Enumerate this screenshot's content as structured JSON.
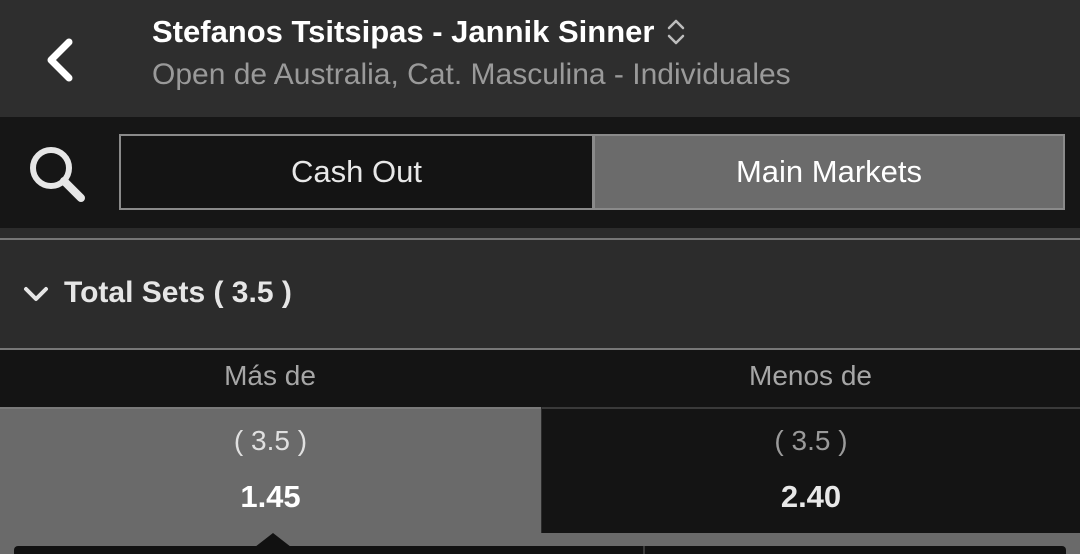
{
  "header": {
    "match_title": "Stefanos Tsitsipas - Jannik Sinner",
    "subtitle": "Open de Australia, Cat. Masculina - Individuales",
    "back_icon": "chevron-left-icon",
    "switch_icon": "chevron-up-down-icon"
  },
  "tabs": {
    "search_icon": "search-icon",
    "items": [
      {
        "label": "Cash Out",
        "active": false
      },
      {
        "label": "Main Markets",
        "active": true
      }
    ]
  },
  "market": {
    "title": "Total Sets",
    "line_label": "( 3.5 )",
    "expanded": true,
    "columns": {
      "over": "Más de",
      "under": "Menos de"
    },
    "selections": {
      "over": {
        "line": "( 3.5 )",
        "price": "1.45",
        "selected": true
      },
      "under": {
        "line": "( 3.5 )",
        "price": "2.40",
        "selected": false
      }
    }
  },
  "colors": {
    "background": "#2b2b2b",
    "tabbar": "#161616",
    "active_tab": "#6b6b6b",
    "selected_odds": "#6a6a6a"
  }
}
